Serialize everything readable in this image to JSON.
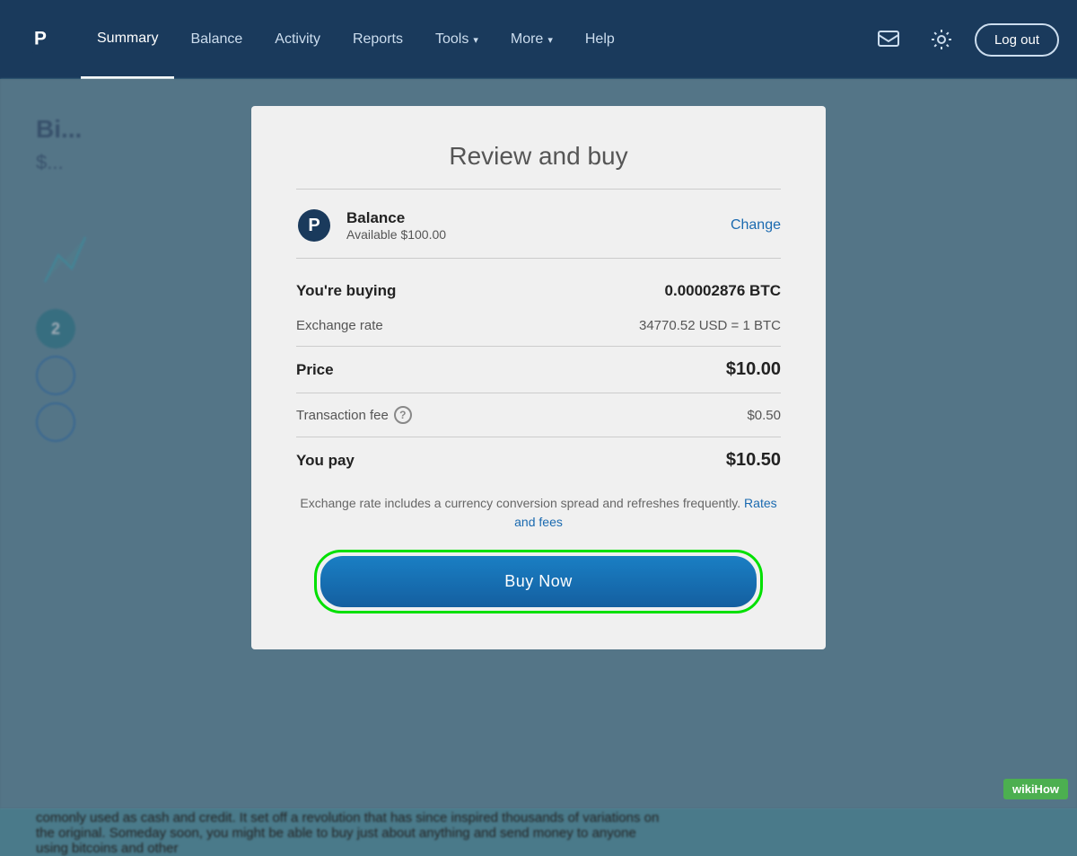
{
  "navbar": {
    "logo_symbol": "P",
    "items": [
      {
        "label": "Summary",
        "active": true
      },
      {
        "label": "Balance",
        "active": false
      },
      {
        "label": "Activity",
        "active": false
      },
      {
        "label": "Reports",
        "active": false
      },
      {
        "label": "Tools",
        "active": false,
        "has_caret": true
      },
      {
        "label": "More",
        "active": false,
        "has_caret": true
      },
      {
        "label": "Help",
        "active": false
      }
    ],
    "logout_label": "Log out"
  },
  "background": {
    "title": "Bi...",
    "subtitle": "$...",
    "body_text": "comonly used as cash and credit. It set off a revolution that has since inspired thousands of variations on the original. Someday soon, you might be able to buy just about anything and send money to anyone using bitcoins and other"
  },
  "modal": {
    "title": "Review and buy",
    "payment_method": {
      "label": "Balance",
      "available": "Available $100.00",
      "change_label": "Change"
    },
    "you_buying_label": "You're buying",
    "you_buying_value": "0.00002876 BTC",
    "exchange_rate_label": "Exchange rate",
    "exchange_rate_value": "34770.52 USD = 1 BTC",
    "price_label": "Price",
    "price_value": "$10.00",
    "transaction_fee_label": "Transaction fee",
    "transaction_fee_value": "$0.50",
    "you_pay_label": "You pay",
    "you_pay_value": "$10.50",
    "footer_note": "Exchange rate includes a currency conversion spread and refreshes frequently.",
    "rates_fees_label": "Rates and fees",
    "buy_now_label": "Buy Now"
  },
  "wikihow": {
    "badge_text": "wikiHow"
  }
}
